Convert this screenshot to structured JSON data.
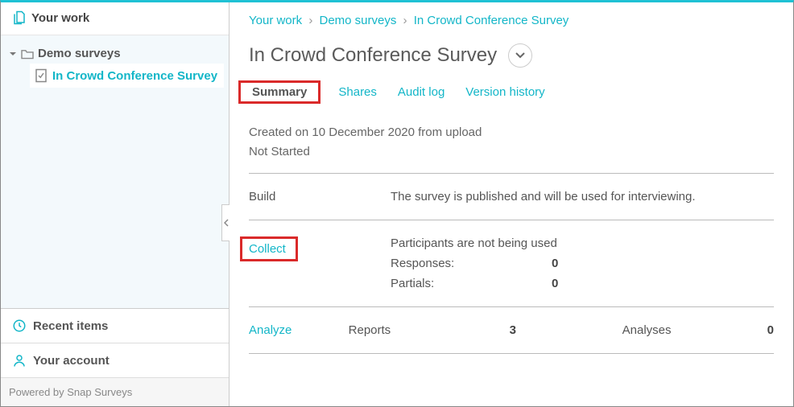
{
  "sidebar": {
    "your_work": "Your work",
    "folder": "Demo surveys",
    "survey": "In Crowd Conference Survey",
    "recent_items": "Recent items",
    "your_account": "Your account",
    "footer": "Powered by Snap Surveys"
  },
  "breadcrumb": {
    "a": "Your work",
    "b": "Demo surveys",
    "c": "In Crowd Conference Survey"
  },
  "page": {
    "title": "In Crowd Conference Survey"
  },
  "tabs": {
    "summary": "Summary",
    "shares": "Shares",
    "audit": "Audit log",
    "version": "Version history"
  },
  "meta": {
    "created": "Created on 10 December 2020 from upload",
    "status": "Not Started"
  },
  "build": {
    "label": "Build",
    "text": "The survey is published and will be used for interviewing."
  },
  "collect": {
    "label": "Collect",
    "text": "Participants are not being used",
    "responses_label": "Responses:",
    "responses_value": "0",
    "partials_label": "Partials:",
    "partials_value": "0"
  },
  "analyze": {
    "label": "Analyze",
    "reports_label": "Reports",
    "reports_value": "3",
    "analyses_label": "Analyses",
    "analyses_value": "0"
  }
}
